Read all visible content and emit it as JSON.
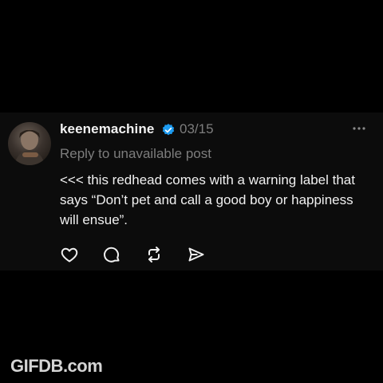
{
  "post": {
    "username": "keenemachine",
    "date": "03/15",
    "reply_context": "Reply to unavailable post",
    "text": "<<< this redhead comes with a warning label that says “Don’t pet and call a good boy or happiness will ensue”.",
    "verified": true,
    "more_icon": "ellipsis-icon",
    "actions": [
      "like",
      "comment",
      "repost",
      "share"
    ]
  },
  "watermark": "GIFDB.com",
  "colors": {
    "background": "#000000",
    "post_background": "#0c0c0c",
    "text": "#f0f0f0",
    "muted": "#7d7d7d",
    "verified": "#1d9bf0"
  }
}
